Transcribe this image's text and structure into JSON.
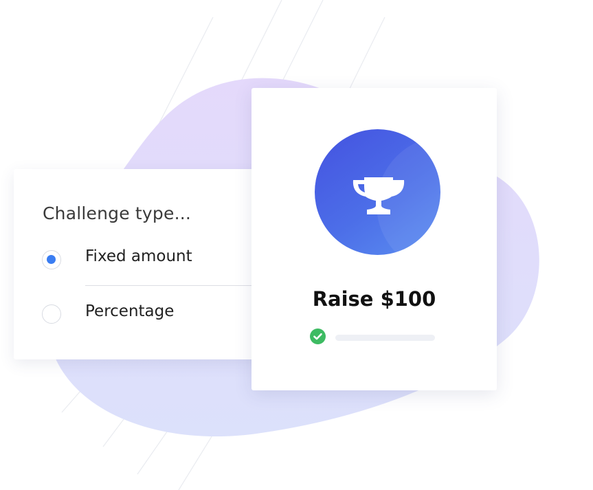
{
  "challenge_type": {
    "title": "Challenge type...",
    "options": [
      {
        "label": "Fixed amount",
        "selected": true
      },
      {
        "label": "Percentage",
        "selected": false
      }
    ]
  },
  "goal_card": {
    "badge_icon": "trophy-icon",
    "goal_text": "Raise $100",
    "status_icon": "check-circle-icon",
    "progress": 0
  },
  "colors": {
    "accent_blue": "#3a7df2",
    "badge_gradient_start": "#4452e0",
    "badge_gradient_end": "#5b8ef0",
    "success_green": "#3dbb62",
    "blob": "#dcdcfb"
  }
}
